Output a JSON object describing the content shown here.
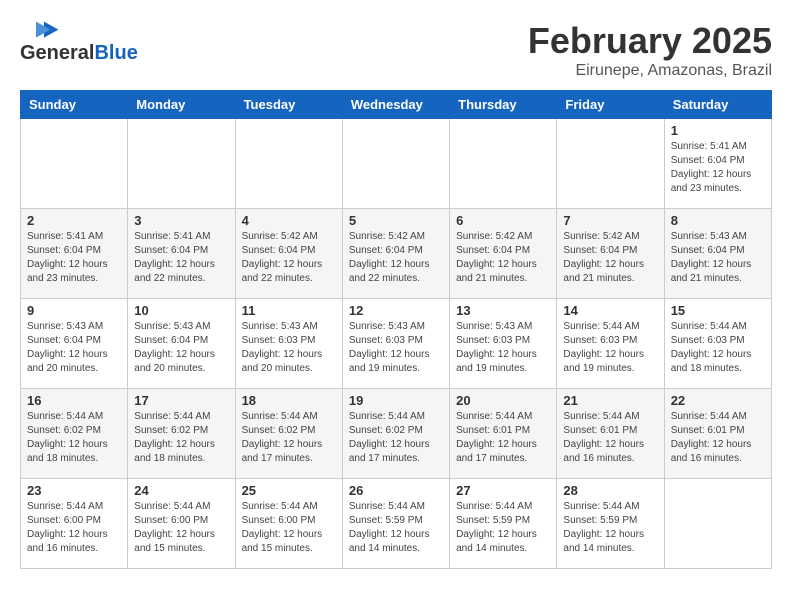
{
  "header": {
    "logo_general": "General",
    "logo_blue": "Blue",
    "title": "February 2025",
    "subtitle": "Eirunepe, Amazonas, Brazil"
  },
  "weekdays": [
    "Sunday",
    "Monday",
    "Tuesday",
    "Wednesday",
    "Thursday",
    "Friday",
    "Saturday"
  ],
  "weeks": [
    [
      {
        "day": "",
        "info": ""
      },
      {
        "day": "",
        "info": ""
      },
      {
        "day": "",
        "info": ""
      },
      {
        "day": "",
        "info": ""
      },
      {
        "day": "",
        "info": ""
      },
      {
        "day": "",
        "info": ""
      },
      {
        "day": "1",
        "info": "Sunrise: 5:41 AM\nSunset: 6:04 PM\nDaylight: 12 hours\nand 23 minutes."
      }
    ],
    [
      {
        "day": "2",
        "info": "Sunrise: 5:41 AM\nSunset: 6:04 PM\nDaylight: 12 hours\nand 23 minutes."
      },
      {
        "day": "3",
        "info": "Sunrise: 5:41 AM\nSunset: 6:04 PM\nDaylight: 12 hours\nand 22 minutes."
      },
      {
        "day": "4",
        "info": "Sunrise: 5:42 AM\nSunset: 6:04 PM\nDaylight: 12 hours\nand 22 minutes."
      },
      {
        "day": "5",
        "info": "Sunrise: 5:42 AM\nSunset: 6:04 PM\nDaylight: 12 hours\nand 22 minutes."
      },
      {
        "day": "6",
        "info": "Sunrise: 5:42 AM\nSunset: 6:04 PM\nDaylight: 12 hours\nand 21 minutes."
      },
      {
        "day": "7",
        "info": "Sunrise: 5:42 AM\nSunset: 6:04 PM\nDaylight: 12 hours\nand 21 minutes."
      },
      {
        "day": "8",
        "info": "Sunrise: 5:43 AM\nSunset: 6:04 PM\nDaylight: 12 hours\nand 21 minutes."
      }
    ],
    [
      {
        "day": "9",
        "info": "Sunrise: 5:43 AM\nSunset: 6:04 PM\nDaylight: 12 hours\nand 20 minutes."
      },
      {
        "day": "10",
        "info": "Sunrise: 5:43 AM\nSunset: 6:04 PM\nDaylight: 12 hours\nand 20 minutes."
      },
      {
        "day": "11",
        "info": "Sunrise: 5:43 AM\nSunset: 6:03 PM\nDaylight: 12 hours\nand 20 minutes."
      },
      {
        "day": "12",
        "info": "Sunrise: 5:43 AM\nSunset: 6:03 PM\nDaylight: 12 hours\nand 19 minutes."
      },
      {
        "day": "13",
        "info": "Sunrise: 5:43 AM\nSunset: 6:03 PM\nDaylight: 12 hours\nand 19 minutes."
      },
      {
        "day": "14",
        "info": "Sunrise: 5:44 AM\nSunset: 6:03 PM\nDaylight: 12 hours\nand 19 minutes."
      },
      {
        "day": "15",
        "info": "Sunrise: 5:44 AM\nSunset: 6:03 PM\nDaylight: 12 hours\nand 18 minutes."
      }
    ],
    [
      {
        "day": "16",
        "info": "Sunrise: 5:44 AM\nSunset: 6:02 PM\nDaylight: 12 hours\nand 18 minutes."
      },
      {
        "day": "17",
        "info": "Sunrise: 5:44 AM\nSunset: 6:02 PM\nDaylight: 12 hours\nand 18 minutes."
      },
      {
        "day": "18",
        "info": "Sunrise: 5:44 AM\nSunset: 6:02 PM\nDaylight: 12 hours\nand 17 minutes."
      },
      {
        "day": "19",
        "info": "Sunrise: 5:44 AM\nSunset: 6:02 PM\nDaylight: 12 hours\nand 17 minutes."
      },
      {
        "day": "20",
        "info": "Sunrise: 5:44 AM\nSunset: 6:01 PM\nDaylight: 12 hours\nand 17 minutes."
      },
      {
        "day": "21",
        "info": "Sunrise: 5:44 AM\nSunset: 6:01 PM\nDaylight: 12 hours\nand 16 minutes."
      },
      {
        "day": "22",
        "info": "Sunrise: 5:44 AM\nSunset: 6:01 PM\nDaylight: 12 hours\nand 16 minutes."
      }
    ],
    [
      {
        "day": "23",
        "info": "Sunrise: 5:44 AM\nSunset: 6:00 PM\nDaylight: 12 hours\nand 16 minutes."
      },
      {
        "day": "24",
        "info": "Sunrise: 5:44 AM\nSunset: 6:00 PM\nDaylight: 12 hours\nand 15 minutes."
      },
      {
        "day": "25",
        "info": "Sunrise: 5:44 AM\nSunset: 6:00 PM\nDaylight: 12 hours\nand 15 minutes."
      },
      {
        "day": "26",
        "info": "Sunrise: 5:44 AM\nSunset: 5:59 PM\nDaylight: 12 hours\nand 14 minutes."
      },
      {
        "day": "27",
        "info": "Sunrise: 5:44 AM\nSunset: 5:59 PM\nDaylight: 12 hours\nand 14 minutes."
      },
      {
        "day": "28",
        "info": "Sunrise: 5:44 AM\nSunset: 5:59 PM\nDaylight: 12 hours\nand 14 minutes."
      },
      {
        "day": "",
        "info": ""
      }
    ]
  ]
}
